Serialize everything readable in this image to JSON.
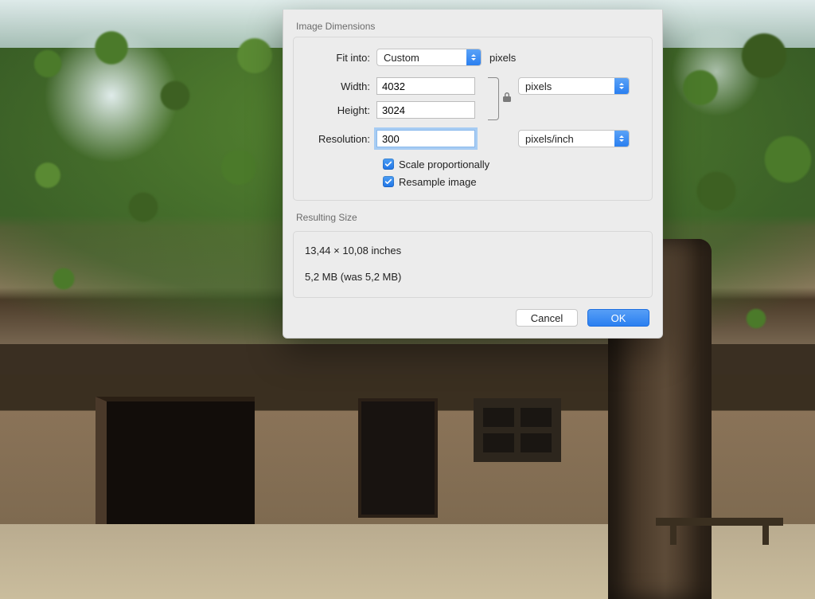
{
  "dialog": {
    "section_dimensions_title": "Image Dimensions",
    "section_result_title": "Resulting Size",
    "fit_into": {
      "label": "Fit into:",
      "value": "Custom",
      "unit": "pixels"
    },
    "width": {
      "label": "Width:",
      "value": "4032"
    },
    "height": {
      "label": "Height:",
      "value": "3024"
    },
    "size_unit": "pixels",
    "resolution": {
      "label": "Resolution:",
      "value": "300",
      "unit": "pixels/inch"
    },
    "scale_proportionally_label": "Scale proportionally",
    "resample_image_label": "Resample image",
    "result_dimensions": "13,44 × 10,08 inches",
    "result_filesize": "5,2 MB (was 5,2 MB)",
    "cancel_label": "Cancel",
    "ok_label": "OK"
  }
}
